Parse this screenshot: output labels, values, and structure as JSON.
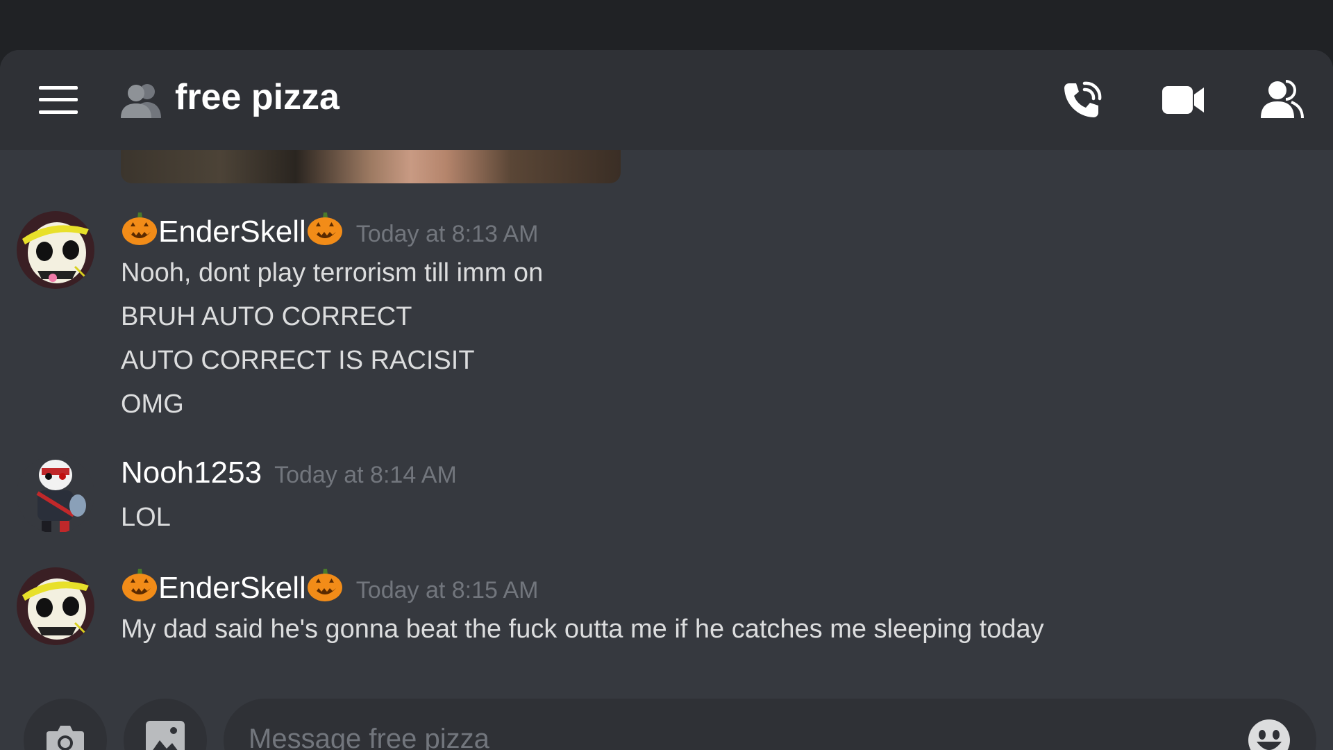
{
  "header": {
    "channel_name": "free pizza"
  },
  "messages": [
    {
      "author": "EnderSkell",
      "author_emoji": "jack-o-lantern",
      "timestamp": "Today at 8:13 AM",
      "lines": [
        "Nooh, dont play terrorism till imm on",
        "BRUH AUTO CORRECT",
        "AUTO CORRECT IS RACISIT",
        "OMG"
      ]
    },
    {
      "author": "Nooh1253",
      "timestamp": "Today at 8:14 AM",
      "lines": [
        "LOL"
      ]
    },
    {
      "author": "EnderSkell",
      "author_emoji": "jack-o-lantern",
      "timestamp": "Today at 8:15 AM",
      "lines": [
        "My dad said he's gonna beat the fuck outta me if he catches me sleeping today"
      ]
    }
  ],
  "composer": {
    "placeholder": "Message free pizza"
  },
  "colors": {
    "background": "#36393f",
    "header": "#2f3136",
    "top_bar": "#202225",
    "timestamp": "#72767d",
    "text": "#dcddde"
  }
}
